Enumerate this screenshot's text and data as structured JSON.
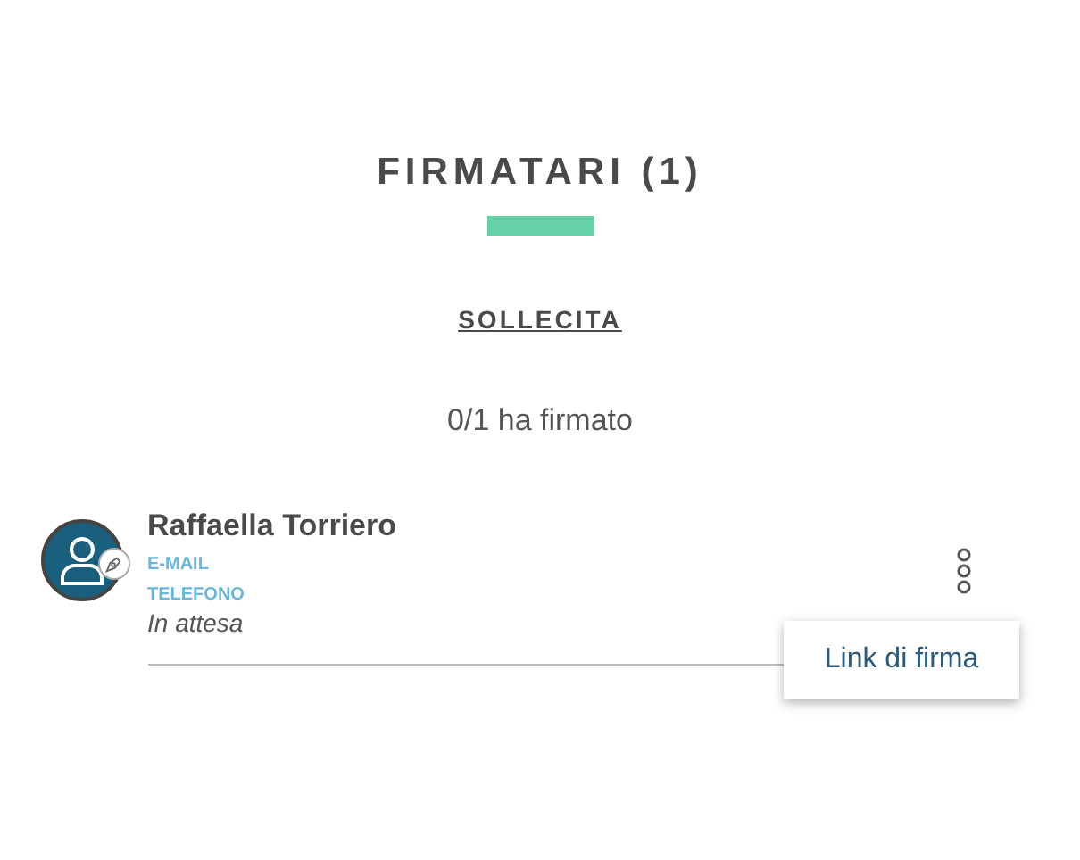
{
  "title": "FIRMATARI (1)",
  "action": "SOLLECITA",
  "summary": "0/1 ha firmato",
  "signers": [
    {
      "name": "Raffaella Torriero",
      "email_label": "E-MAIL",
      "phone_label": "TELEFONO",
      "status": "In attesa"
    }
  ],
  "menu": {
    "items": [
      "Link di firma"
    ]
  }
}
